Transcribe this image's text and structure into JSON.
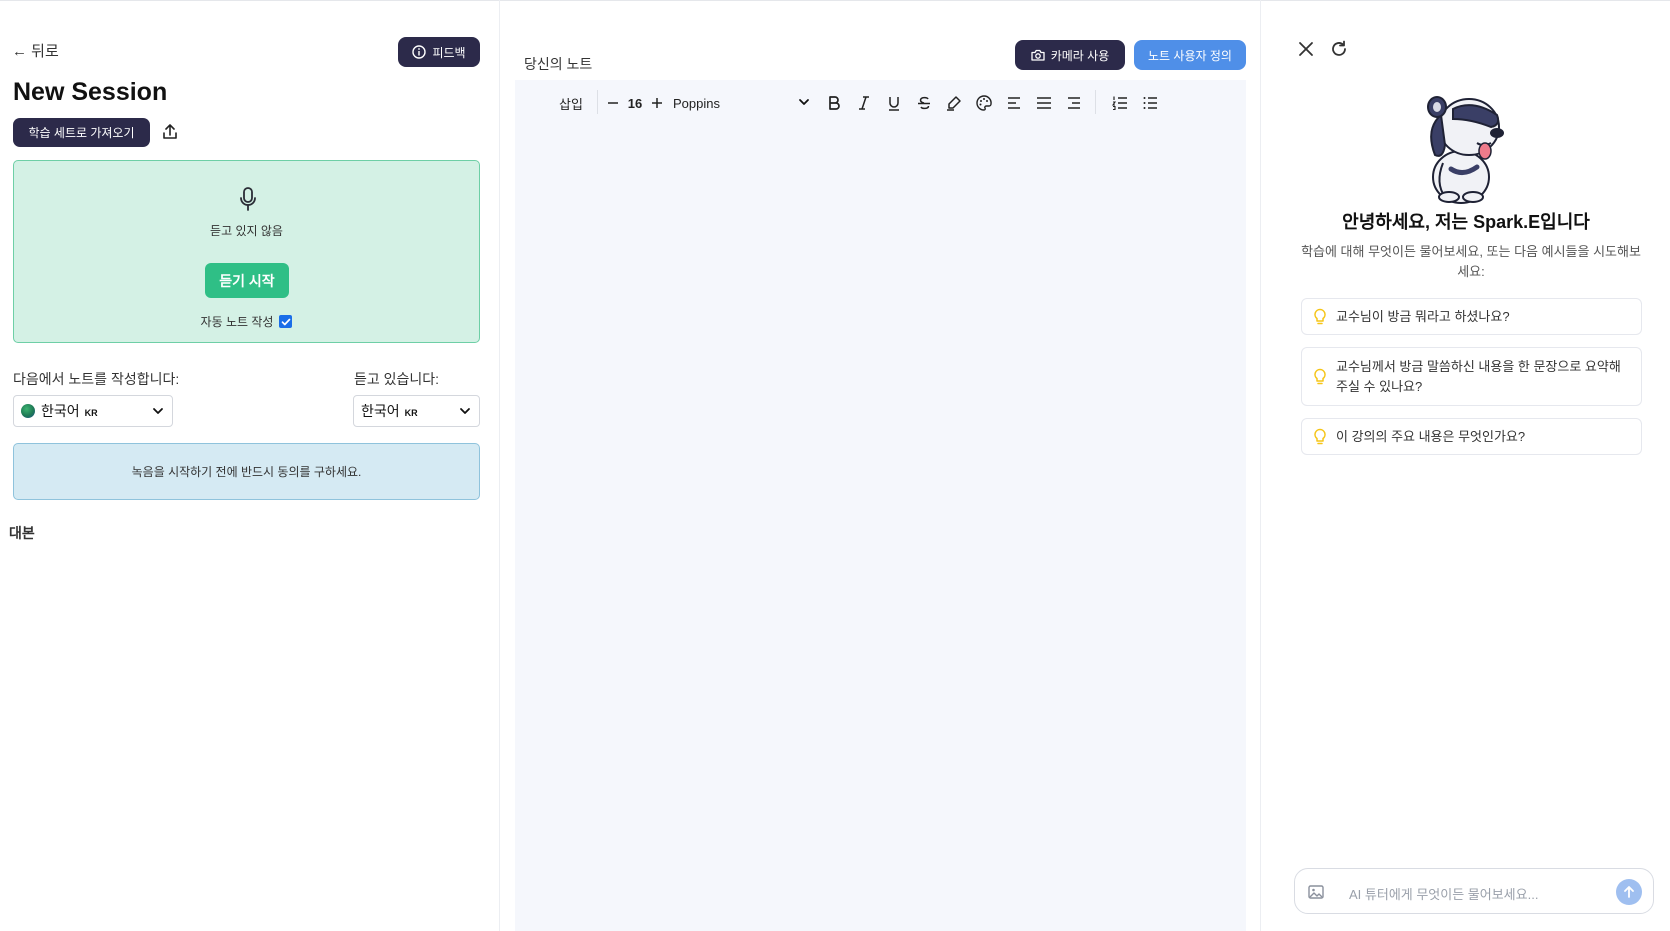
{
  "left": {
    "back_label": "← 뒤로",
    "feedback_label": "피드백",
    "title": "New Session",
    "import_label": "학습 세트로 가져오기",
    "listen_status": "듣고 있지 않음",
    "start_label": "듣기 시작",
    "auto_note_label": "자동 노트 작성",
    "auto_note_checked": true,
    "note_lang_label": "다음에서 노트를 작성합니다:",
    "listen_lang_label": "듣고 있습니다:",
    "note_lang": {
      "value": "한국어",
      "code": "KR"
    },
    "listen_lang": {
      "value": "한국어",
      "code": "KR"
    },
    "consent_text": "녹음을 시작하기 전에 반드시 동의를 구하세요.",
    "transcript_label": "대본"
  },
  "middle": {
    "notes_title": "당신의 노트",
    "camera_label": "카메라 사용",
    "customize_label": "노트 사용자 정의",
    "toolbar": {
      "insert_label": "삽입",
      "font_size": "16",
      "font_family": "Poppins"
    }
  },
  "right": {
    "greeting": "안녕하세요, 저는 Spark.E입니다",
    "subtitle": "학습에 대해 무엇이든 물어보세요, 또는 다음 예시들을 시도해보세요:",
    "suggestions": [
      "교수님이 방금 뭐라고 하셨나요?",
      "교수님께서 방금 말씀하신 내용을 한 문장으로 요약해 주실 수 있나요?",
      "이 강의의 주요 내용은 무엇인가요?"
    ],
    "chat_placeholder": "AI 튜터에게 무엇이든 물어보세요..."
  },
  "colors": {
    "dark_button": "#2c2a4a",
    "accent_blue": "#4f8fe8",
    "listen_green": "#2fbf86",
    "listen_bg": "#d4f1e5",
    "consent_bg": "#d5eaf3"
  }
}
